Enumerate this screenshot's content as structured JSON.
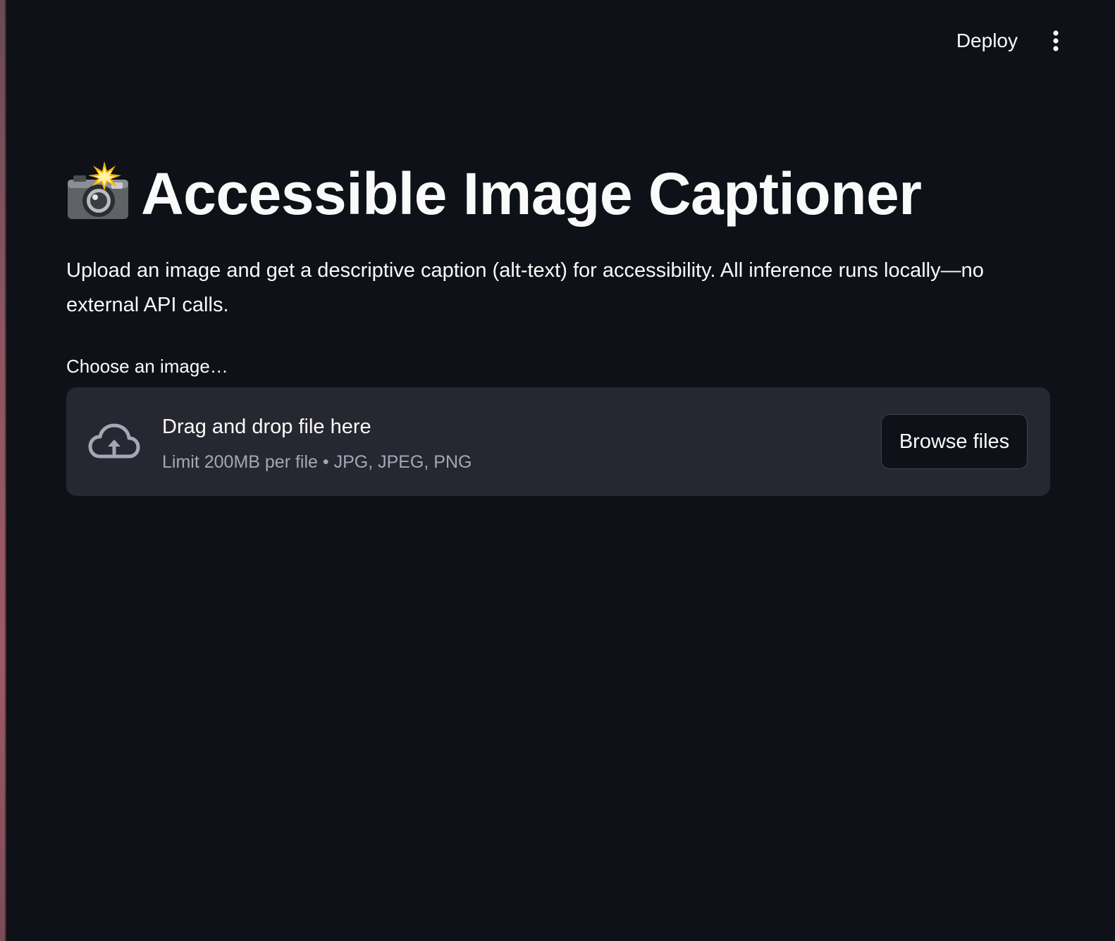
{
  "header": {
    "deploy_label": "Deploy",
    "menu_icon": "vertical-ellipsis-icon"
  },
  "main": {
    "title_icon": "camera-with-flash-icon",
    "title": "Accessible Image Captioner",
    "description": "Upload an image and get a descriptive caption (alt-text) for accessibility. All inference runs locally—no external API calls.",
    "uploader": {
      "label": "Choose an image…",
      "icon": "cloud-upload-icon",
      "drop_title": "Drag and drop file here",
      "limit_text": "Limit 200MB per file • JPG, JPEG, PNG",
      "browse_label": "Browse files"
    }
  },
  "colors": {
    "background": "#0e1117",
    "dropzone": "#262730",
    "text": "#fafafa",
    "muted_text": "#a3a8b8"
  }
}
